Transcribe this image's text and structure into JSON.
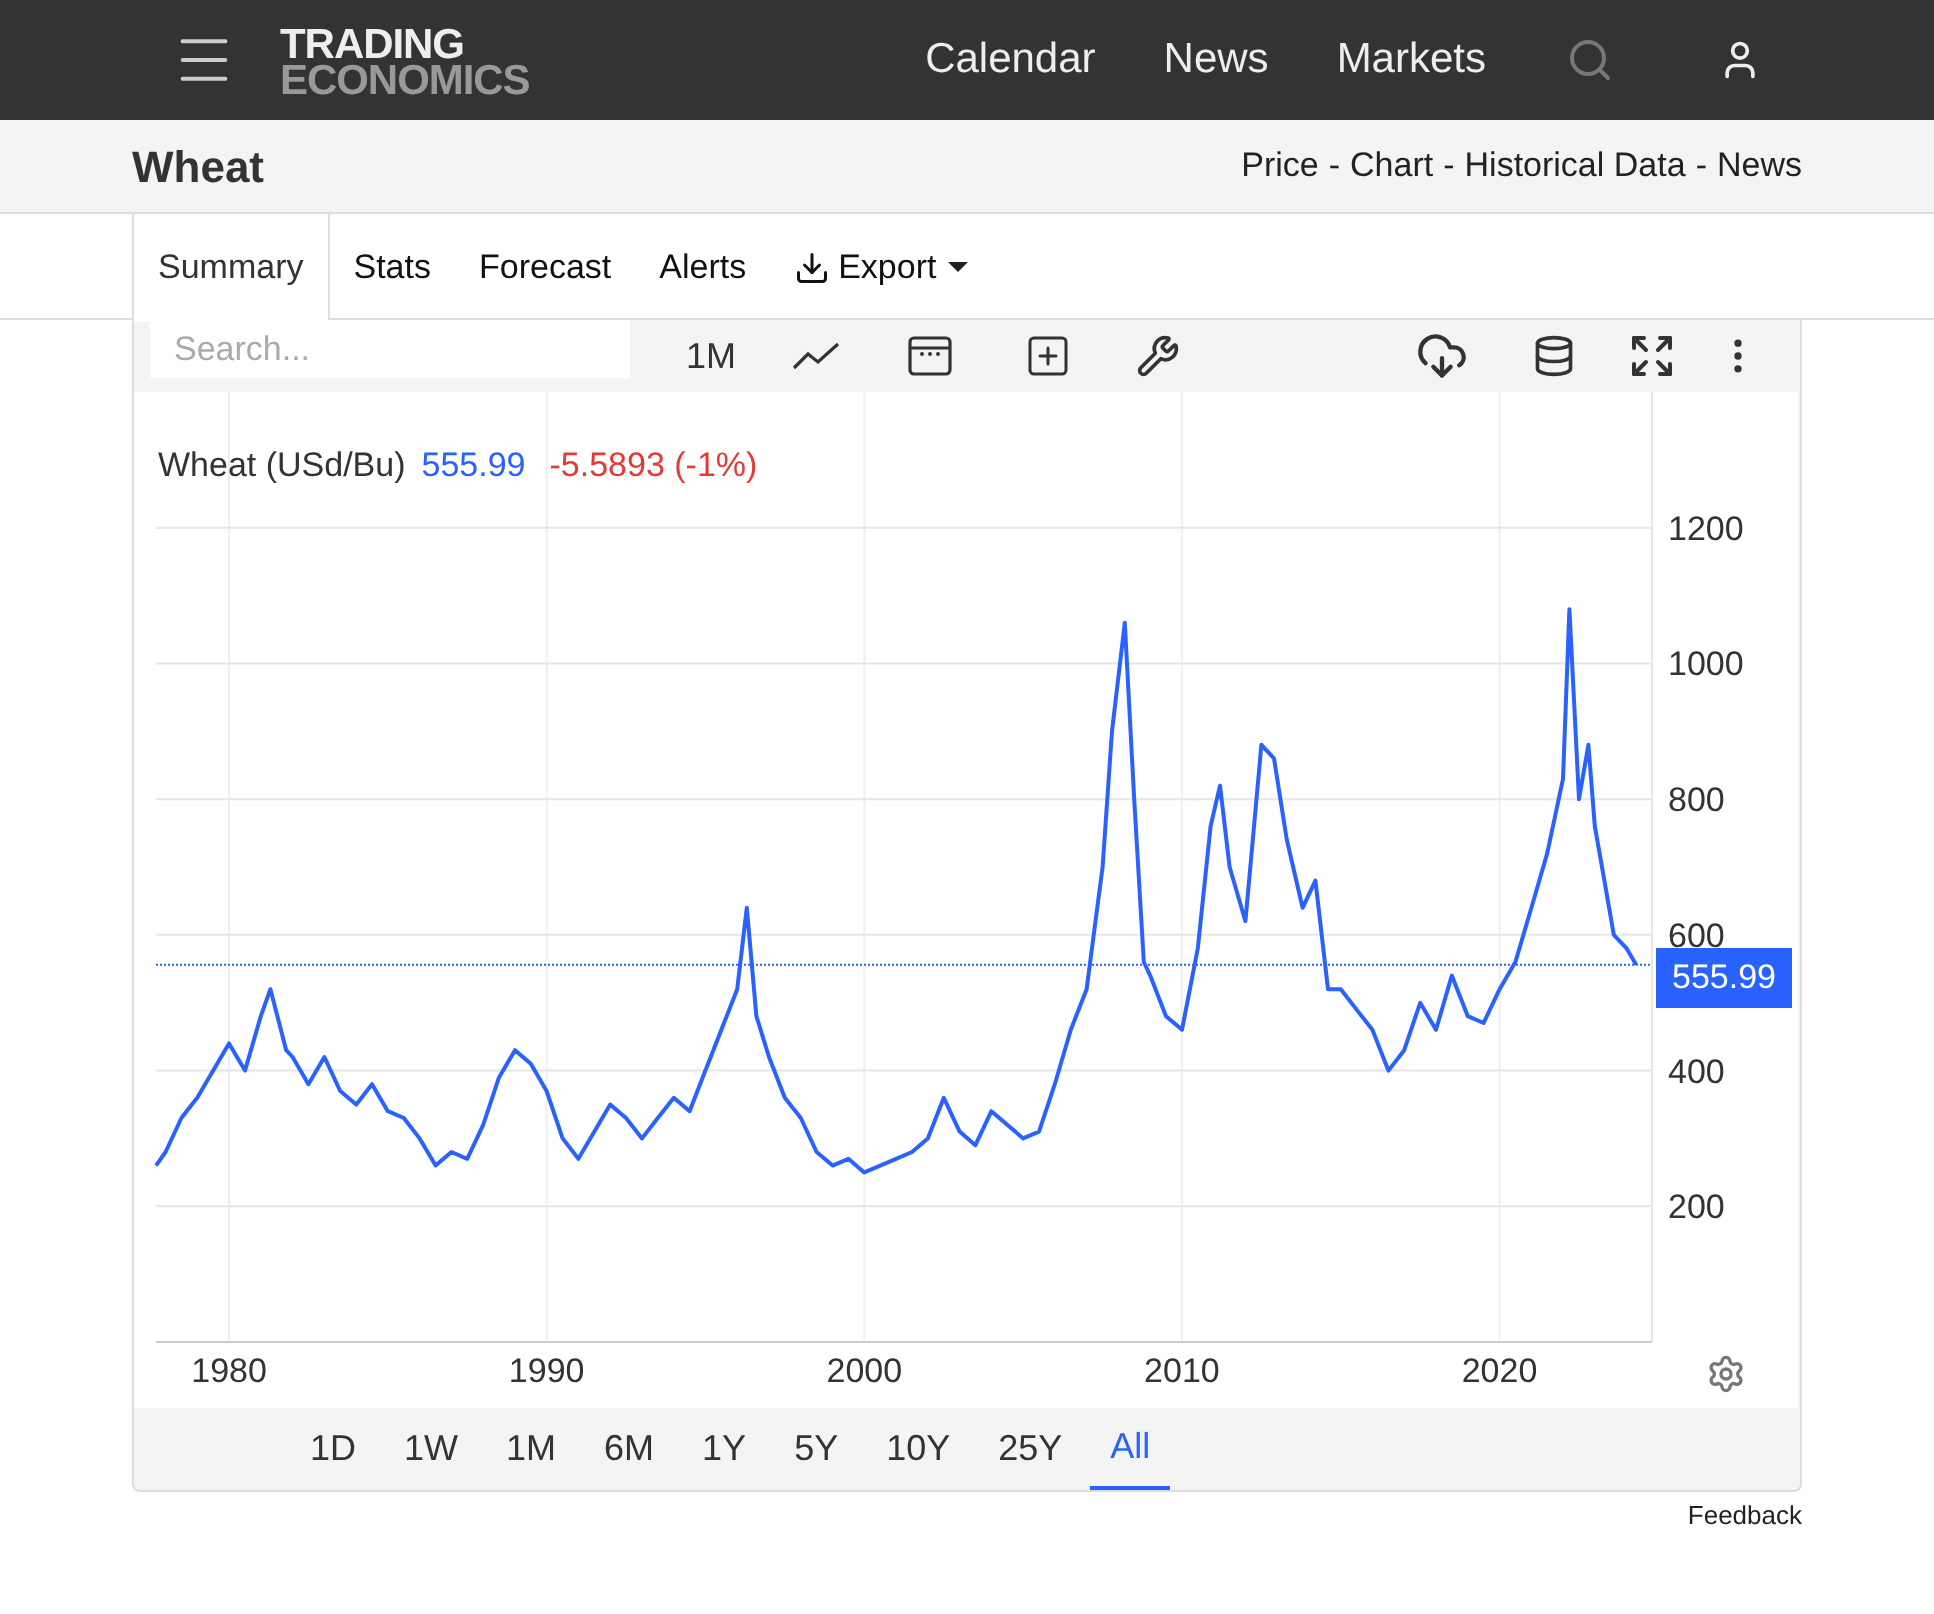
{
  "header": {
    "logo": [
      "TRADING",
      "ECONOMICS"
    ],
    "nav": [
      "Calendar",
      "News",
      "Markets"
    ]
  },
  "page": {
    "title": "Wheat",
    "links": [
      "Price",
      "Chart",
      "Historical Data",
      "News"
    ],
    "separator": "-"
  },
  "tabs": [
    {
      "label": "Summary",
      "selected": true,
      "kind": "tab"
    },
    {
      "label": "Stats",
      "selected": false,
      "kind": "tab"
    },
    {
      "label": "Forecast",
      "selected": false,
      "kind": "tab"
    },
    {
      "label": "Alerts",
      "selected": false,
      "kind": "tab"
    },
    {
      "label": "Export",
      "selected": false,
      "kind": "menu"
    }
  ],
  "toolbar": {
    "search": {
      "placeholder": "Search..."
    },
    "interval": "1M"
  },
  "legend": {
    "name": "Wheat (USd/Bu)",
    "value": "555.99",
    "change": "-5.5893 (-1%)"
  },
  "chart_data": {
    "type": "line",
    "xlim": [
      1977.7,
      2024.8
    ],
    "ylim": [
      0,
      1400
    ],
    "xticks": [
      1980,
      1990,
      2000,
      2010,
      2020
    ],
    "yticks": [
      200,
      400,
      600,
      800,
      1000,
      1200
    ],
    "grid": true,
    "ref_lines": [
      {
        "value": 555.99,
        "label": "555.99",
        "color": "#2962ff",
        "axis": "y"
      }
    ],
    "x": [
      1977.7,
      1978,
      1978.5,
      1979,
      1979.5,
      1980,
      1980.5,
      1981,
      1981.3,
      1981.8,
      1982,
      1982.5,
      1983,
      1983.5,
      1984,
      1984.5,
      1985,
      1985.5,
      1986,
      1986.5,
      1987,
      1987.5,
      1988,
      1988.5,
      1989,
      1989.5,
      1990,
      1990.5,
      1991,
      1991.5,
      1992,
      1992.5,
      1993,
      1993.5,
      1994,
      1994.5,
      1995,
      1995.5,
      1996,
      1996.3,
      1996.6,
      1997,
      1997.5,
      1998,
      1998.5,
      1999,
      1999.5,
      2000,
      2000.5,
      2001,
      2001.5,
      2002,
      2002.5,
      2003,
      2003.5,
      2004,
      2004.5,
      2005,
      2005.5,
      2006,
      2006.5,
      2007,
      2007.5,
      2007.8,
      2008.2,
      2008.5,
      2008.8,
      2009,
      2009.5,
      2010,
      2010.5,
      2010.9,
      2011.2,
      2011.5,
      2012,
      2012.5,
      2012.9,
      2013.3,
      2013.8,
      2014.2,
      2014.6,
      2015,
      2015.5,
      2016,
      2016.5,
      2017,
      2017.5,
      2018,
      2018.5,
      2019,
      2019.5,
      2020,
      2020.5,
      2021,
      2021.5,
      2022,
      2022.2,
      2022.5,
      2022.8,
      2023,
      2023.3,
      2023.6,
      2024,
      2024.3
    ],
    "series": [
      {
        "color": "#2962ff",
        "values": [
          260,
          280,
          330,
          360,
          400,
          440,
          400,
          480,
          520,
          430,
          420,
          380,
          420,
          370,
          350,
          380,
          340,
          330,
          300,
          260,
          280,
          270,
          320,
          390,
          430,
          410,
          370,
          300,
          270,
          310,
          350,
          330,
          300,
          330,
          360,
          340,
          400,
          460,
          520,
          640,
          480,
          420,
          360,
          330,
          280,
          260,
          270,
          250,
          260,
          270,
          280,
          300,
          360,
          310,
          290,
          340,
          320,
          300,
          310,
          380,
          460,
          520,
          700,
          900,
          1060,
          800,
          560,
          540,
          480,
          460,
          580,
          760,
          820,
          700,
          620,
          880,
          860,
          740,
          640,
          680,
          520,
          520,
          490,
          460,
          400,
          430,
          500,
          460,
          540,
          480,
          470,
          520,
          560,
          640,
          720,
          830,
          1080,
          800,
          880,
          760,
          680,
          600,
          580,
          556
        ]
      }
    ]
  },
  "ranges": [
    {
      "label": "1D",
      "selected": false
    },
    {
      "label": "1W",
      "selected": false
    },
    {
      "label": "1M",
      "selected": false
    },
    {
      "label": "6M",
      "selected": false
    },
    {
      "label": "1Y",
      "selected": false
    },
    {
      "label": "5Y",
      "selected": false
    },
    {
      "label": "10Y",
      "selected": false
    },
    {
      "label": "25Y",
      "selected": false
    },
    {
      "label": "All",
      "selected": true
    }
  ],
  "feedback": "Feedback"
}
